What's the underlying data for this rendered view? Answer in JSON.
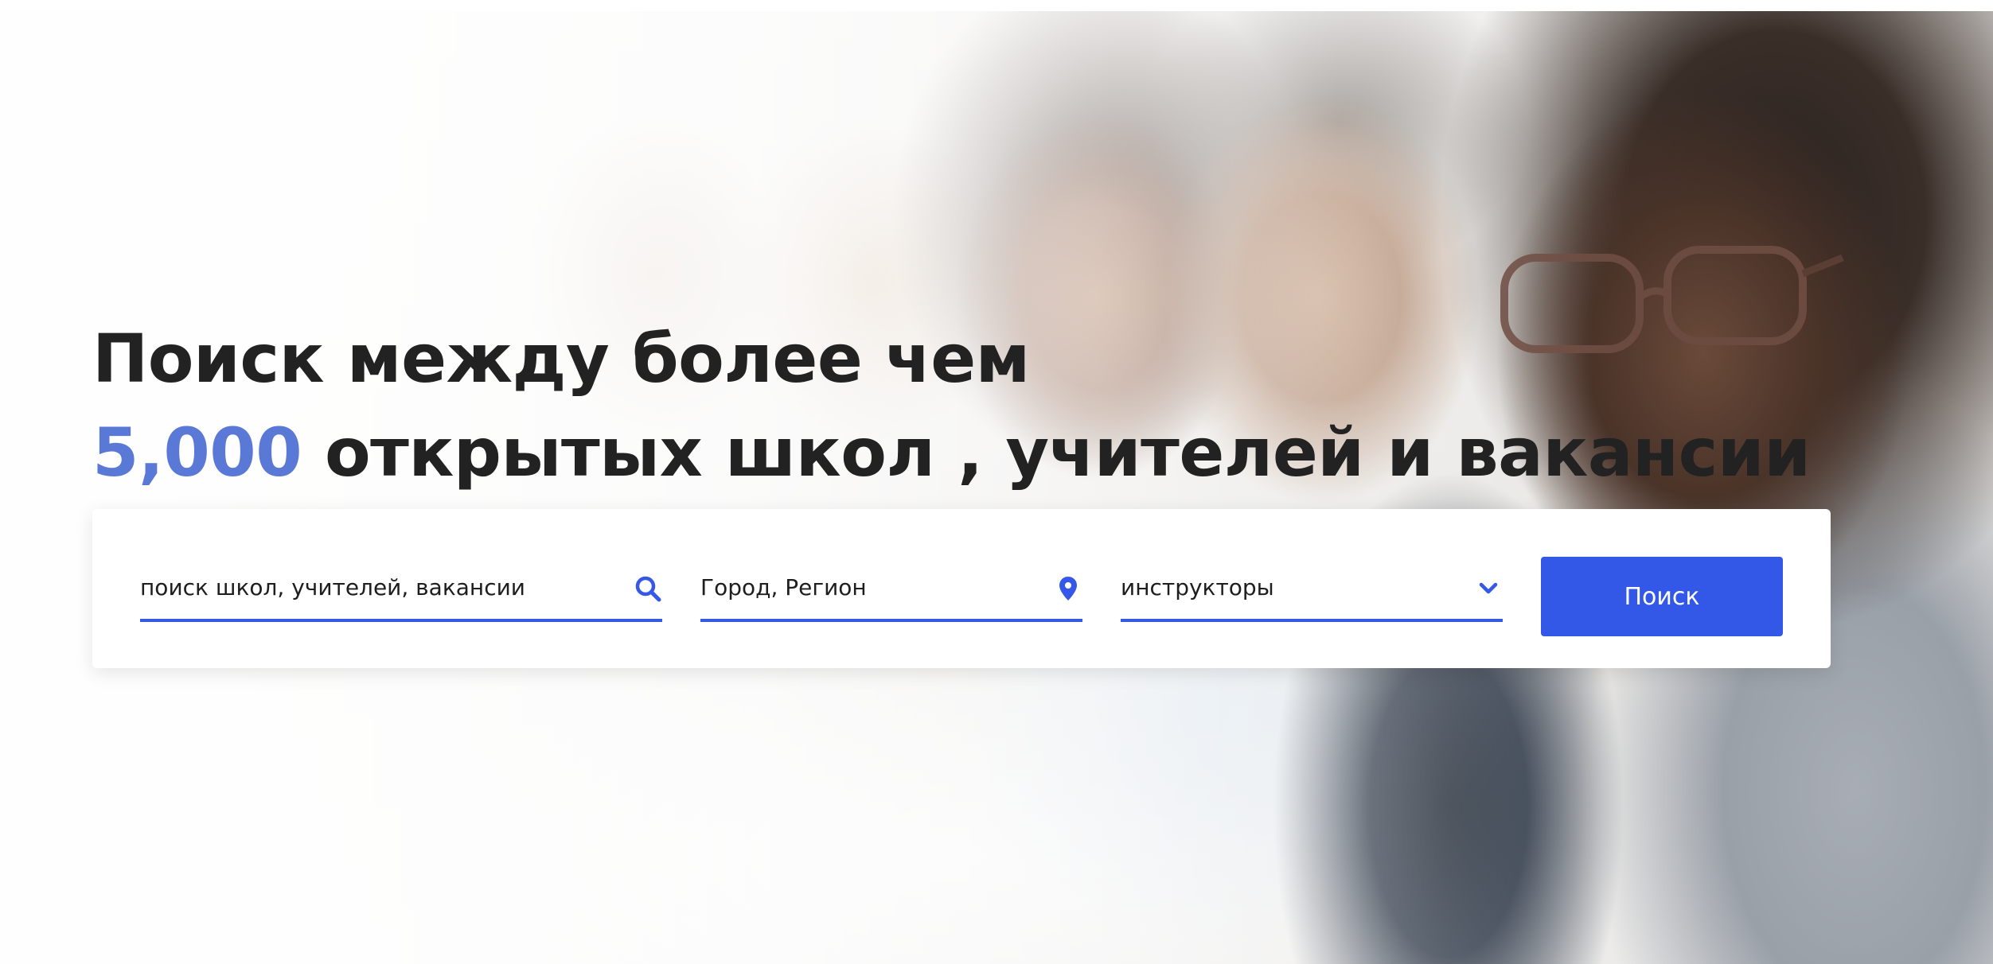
{
  "hero": {
    "headline_line1": "Поиск между более чем",
    "headline_count": "5,000",
    "headline_line2_rest": " открытых школ , учителей и вакансии",
    "accent_color": "#5a78d6"
  },
  "search": {
    "keyword_placeholder": "поиск школ, учителей, вакансии",
    "location_placeholder": "Город, Регион",
    "category_selected": "инструкторы",
    "submit_label": "Поиск",
    "button_color": "#3358e8"
  },
  "icons": {
    "keyword": "search-icon",
    "location": "map-pin-icon",
    "category": "chevron-down-icon"
  }
}
